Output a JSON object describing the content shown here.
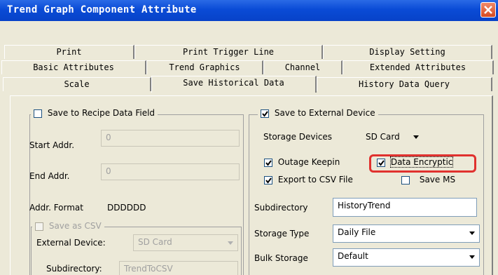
{
  "window": {
    "title": "Trend Graph Component Attribute"
  },
  "tabs": {
    "row1": [
      "Print",
      "Print Trigger Line",
      "Display Setting"
    ],
    "row2": [
      "Basic Attributes",
      "Trend Graphics",
      "Channel",
      "Extended Attributes"
    ],
    "row3": [
      "Scale",
      "Save Historical Data",
      "History Data Query"
    ]
  },
  "recipe": {
    "label": "Save to Recipe Data Field",
    "start_addr_label": "Start Addr.",
    "start_addr_value": "0",
    "end_addr_label": "End Addr.",
    "end_addr_value": "0",
    "addr_format_label": "Addr. Format",
    "addr_format_value": "DDDDDD",
    "save_csv_label": "Save as CSV",
    "external_device_label": "External Device:",
    "external_device_value": "SD Card",
    "subdirectory_label": "Subdirectory:",
    "subdirectory_value": "TrendToCSV"
  },
  "external": {
    "label": "Save to External Device",
    "storage_devices_label": "Storage Devices",
    "storage_devices_value": "SD Card",
    "outage_keepin_label": "Outage Keepin",
    "data_encryptic_label": "Data Encryptic",
    "export_csv_label": "Export to CSV File",
    "save_ms_label": "Save MS",
    "subdirectory_label": "Subdirectory",
    "subdirectory_value": "HistoryTrend",
    "storage_type_label": "Storage Type",
    "storage_type_value": "Daily File",
    "bulk_storage_label": "Bulk Storage",
    "bulk_storage_value": "Default"
  },
  "colors": {
    "title_bar": "#0a4bd6",
    "highlight": "#e0312e",
    "face": "#ece9d8"
  }
}
